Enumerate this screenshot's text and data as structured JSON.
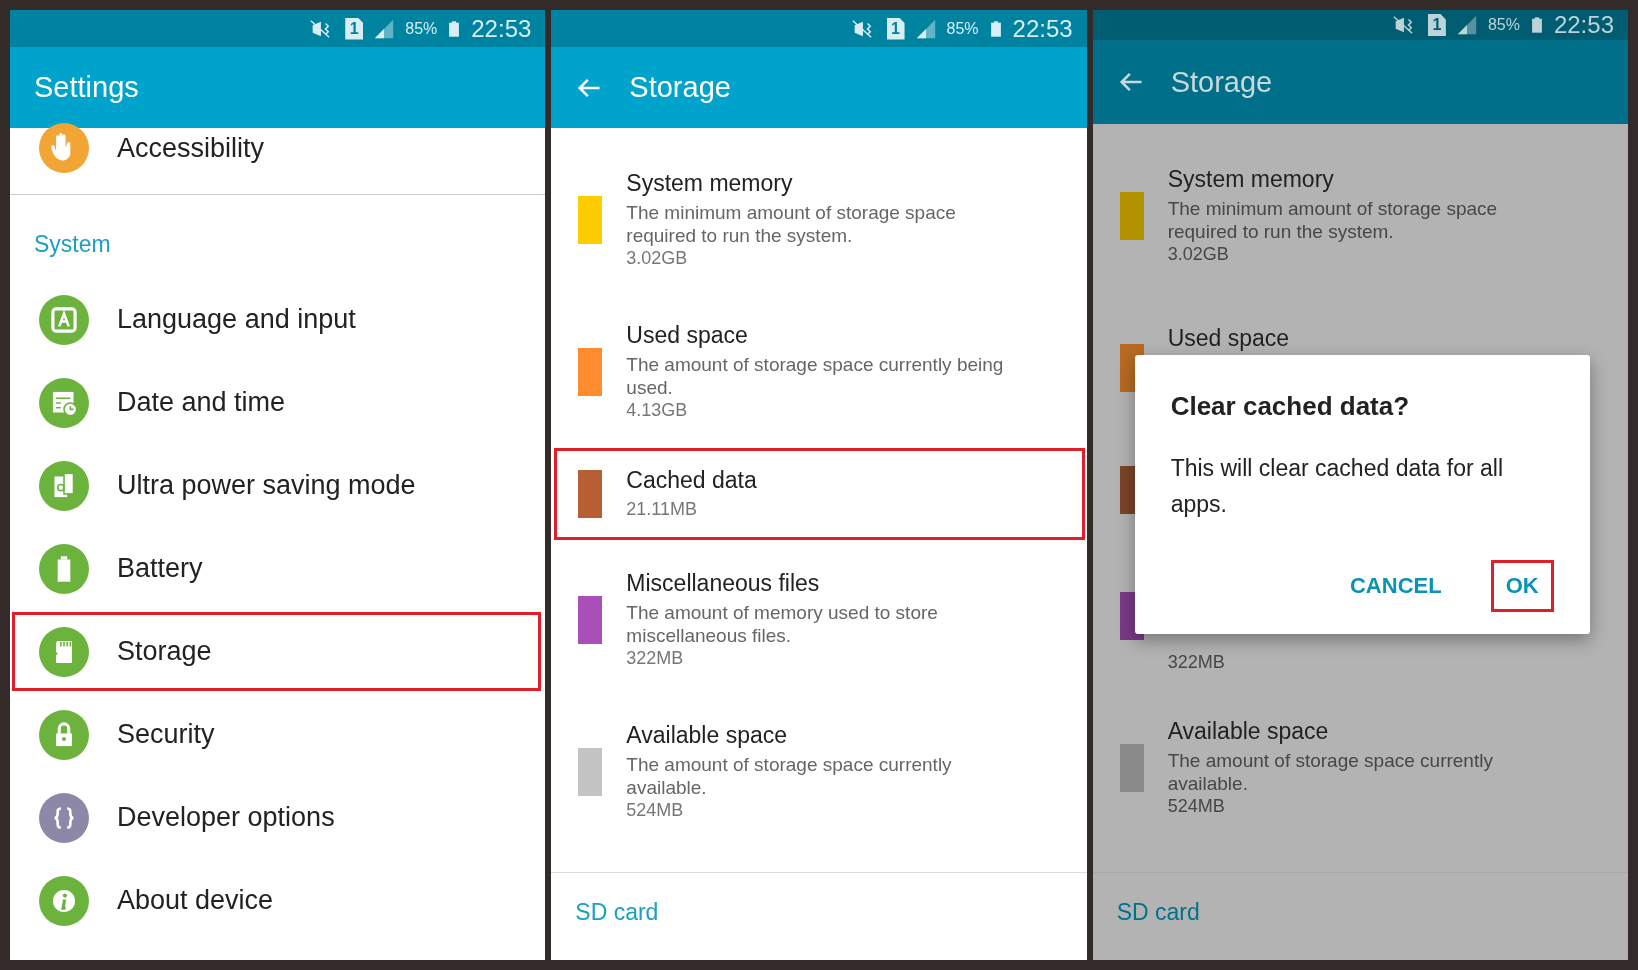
{
  "panels": [
    {
      "kind": "settings",
      "status_bar": {
        "sim": "1",
        "battery": "85%",
        "time": "22:53"
      },
      "app_bar": {
        "title": "Settings",
        "back": false
      },
      "items": [
        {
          "label": "Accessibility",
          "color": "#f0a534",
          "highlighted": false
        }
      ],
      "section": {
        "title": "System",
        "items": [
          {
            "label": "Language and input",
            "color": "#6cb33e",
            "highlighted": false
          },
          {
            "label": "Date and time",
            "color": "#6cb33e",
            "highlighted": false
          },
          {
            "label": "Ultra power saving mode",
            "color": "#6cb33e",
            "highlighted": false
          },
          {
            "label": "Battery",
            "color": "#6cb33e",
            "highlighted": false
          },
          {
            "label": "Storage",
            "color": "#6cb33e",
            "highlighted": true
          },
          {
            "label": "Security",
            "color": "#6cb33e",
            "highlighted": false
          },
          {
            "label": "Developer options",
            "color": "#8e88a8",
            "highlighted": false
          },
          {
            "label": "About device",
            "color": "#6cb33e",
            "highlighted": false
          }
        ]
      }
    },
    {
      "kind": "storage",
      "dimmed": false,
      "status_bar": {
        "sim": "1",
        "battery": "85%",
        "time": "22:53"
      },
      "app_bar": {
        "title": "Storage",
        "back": true
      },
      "entries": [
        {
          "title": "System memory",
          "description": "The minimum amount of storage space required to run the system.",
          "size": "3.02GB",
          "color": "#ffcc00",
          "highlighted": false
        },
        {
          "title": "Used space",
          "description": "The amount of storage space currently being used.",
          "size": "4.13GB",
          "color": "#ff8c2e",
          "highlighted": false
        },
        {
          "title": "Cached data",
          "size": "21.11MB",
          "color": "#b85e35",
          "highlighted": true
        },
        {
          "title": "Miscellaneous files",
          "description": "The amount of memory used to store miscellaneous files.",
          "size": "322MB",
          "color": "#a94fb8",
          "highlighted": false
        },
        {
          "title": "Available space",
          "description": "The amount of storage space currently available.",
          "size": "524MB",
          "color": "#c4c4c4",
          "highlighted": false
        }
      ],
      "footer": "SD card"
    },
    {
      "kind": "storage",
      "dimmed": true,
      "status_bar": {
        "sim": "1",
        "battery": "85%",
        "time": "22:53"
      },
      "app_bar": {
        "title": "Storage",
        "back": true
      },
      "entries": [
        {
          "title": "System memory",
          "description": "The minimum amount of storage space required to run the system.",
          "size": "3.02GB",
          "color": "#b39200",
          "highlighted": false
        },
        {
          "title": "Used space",
          "color": "#b86a22",
          "highlighted": false
        },
        {
          "color": "#7c4428",
          "highlighted": false
        },
        {
          "size": "322MB",
          "color": "#7a3a86",
          "highlighted": false
        },
        {
          "title": "Available space",
          "description": "The amount of storage space currently available.",
          "size": "524MB",
          "color": "#8a8a8a",
          "highlighted": false
        }
      ],
      "footer": "SD card",
      "dialog": {
        "title": "Clear cached data?",
        "message": "This will clear cached data for all apps.",
        "buttons": [
          {
            "label": "CANCEL",
            "highlighted": false
          },
          {
            "label": "OK",
            "highlighted": true
          }
        ]
      }
    }
  ]
}
